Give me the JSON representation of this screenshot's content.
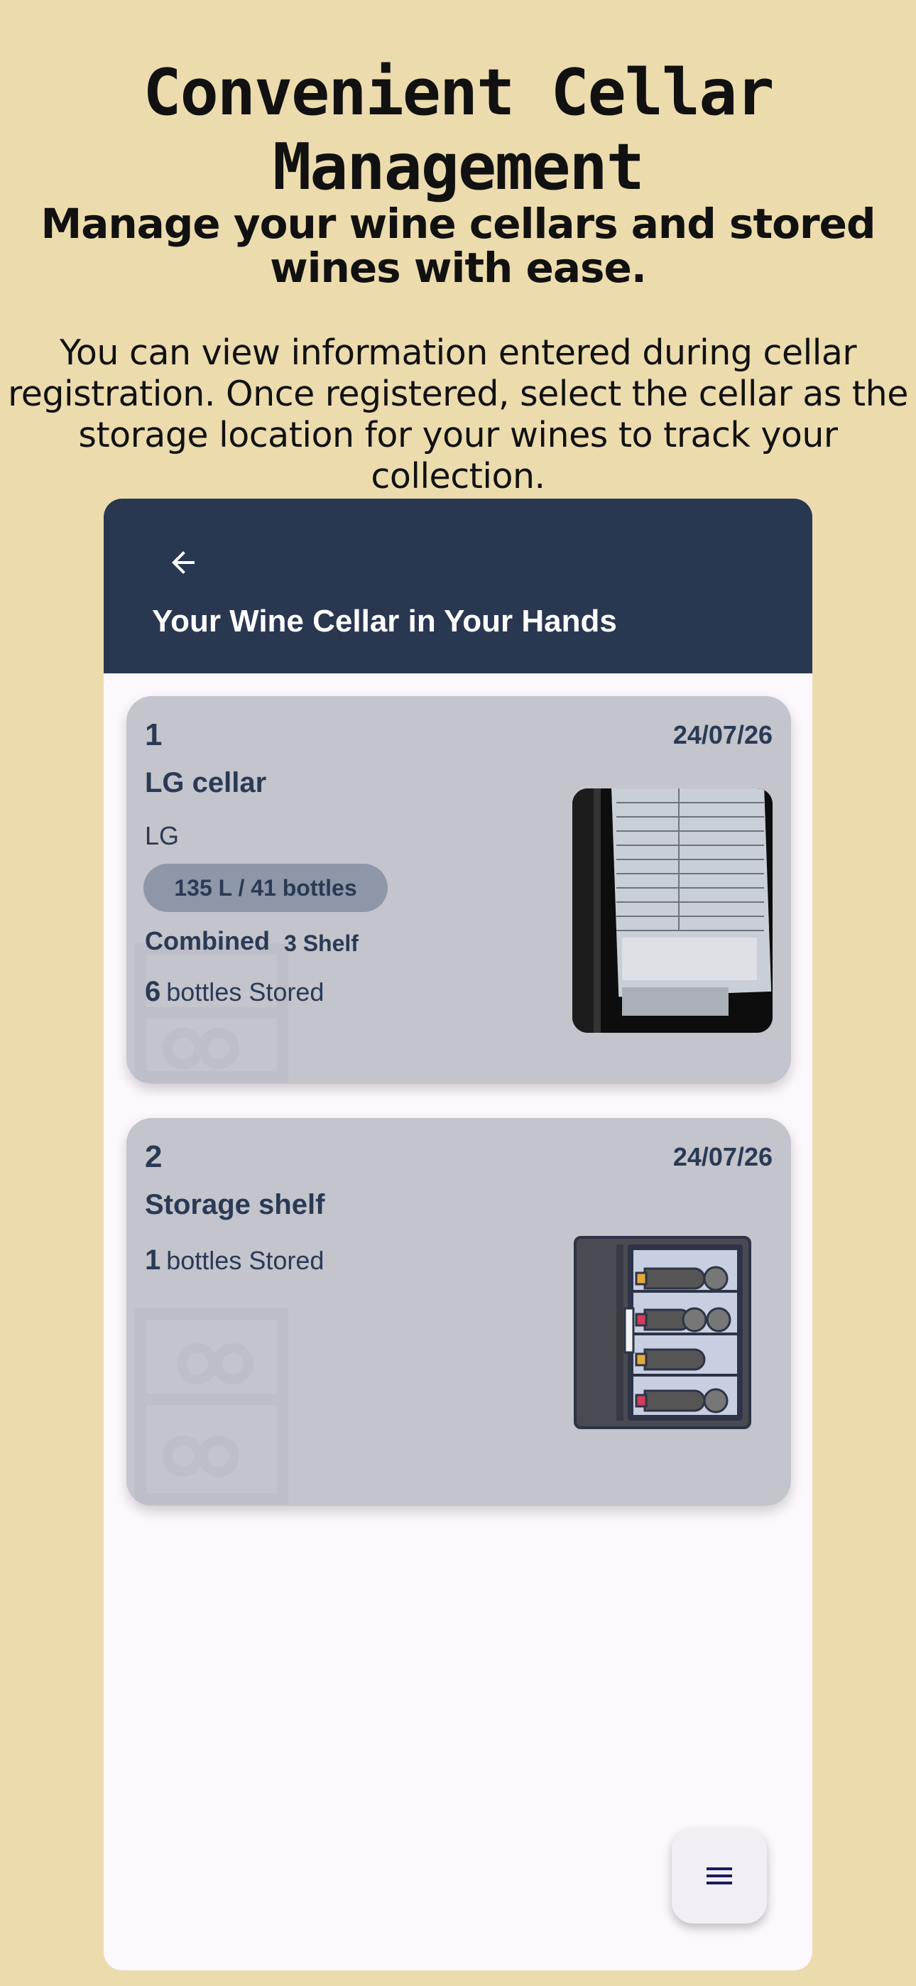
{
  "promo": {
    "title": "Convenient Cellar Management",
    "subtitle": "Manage your wine cellars and stored wines with ease.",
    "description": "You can view information entered during cellar registration. Once registered, select the cellar as the storage location for your wines to track your collection."
  },
  "app_bar": {
    "back_icon": "arrow-left-icon",
    "title": "Your Wine Cellar in Your Hands"
  },
  "cellars": [
    {
      "index": "1",
      "date": "24/07/26",
      "name": "LG cellar",
      "maker": "LG",
      "capacity": "135 L / 41 bottles",
      "type": "Combined",
      "shelves": "3 Shelf",
      "stored_count": "6",
      "stored_label": "bottles Stored",
      "image_icon": "cellar-photo"
    },
    {
      "index": "2",
      "date": "24/07/26",
      "name": "Storage shelf",
      "stored_count": "1",
      "stored_label": "bottles Stored",
      "image_icon": "wine-fridge-icon"
    }
  ],
  "fab": {
    "icon": "menu-icon"
  },
  "colors": {
    "background": "#ecdcad",
    "app_bar": "#293751",
    "card": "#c3c4cc",
    "chip": "#8e97a7",
    "text_dark": "#2a3a55"
  }
}
